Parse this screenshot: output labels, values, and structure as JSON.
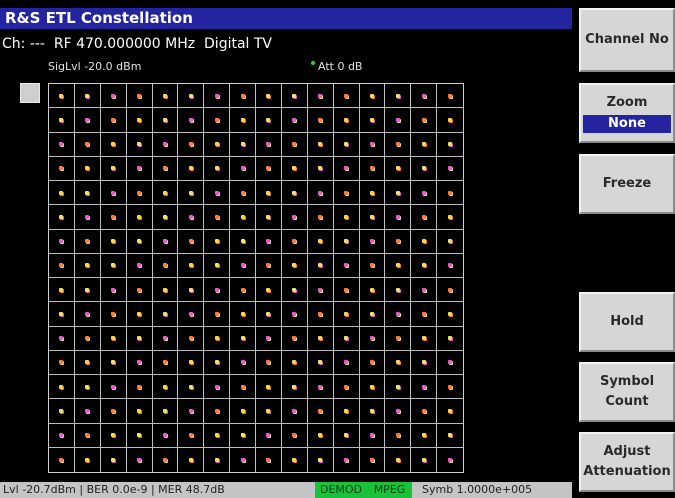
{
  "title": "R&S ETL Constellation",
  "channel_line": "Ch: ---  RF 470.000000 MHz  Digital TV",
  "siglvl": "SigLvl -20.0 dBm",
  "attenuation": "Att 0 dB",
  "constellation": {
    "rows": 16,
    "cols": 16
  },
  "status": {
    "measurements": "Lvl -20.7dBm | BER 0.0e-9 | MER 48.7dB",
    "demod": "DEMOD",
    "mpeg": "MPEG",
    "symb": "Symb 1.0000e+005"
  },
  "softkeys": {
    "channel_no": "Channel No",
    "zoom": "Zoom",
    "zoom_value": "None",
    "freeze": "Freeze",
    "hold": "Hold",
    "symbol_count_1": "Symbol",
    "symbol_count_2": "Count",
    "adjust_att_1": "Adjust",
    "adjust_att_2": "Attenuation"
  },
  "colors": {
    "title_bar": "#2424a0",
    "status_green": "#19c23a",
    "symbol_colors": [
      "#ffd34a",
      "#ff7a3c",
      "#e85ad0",
      "#f0e068"
    ]
  }
}
